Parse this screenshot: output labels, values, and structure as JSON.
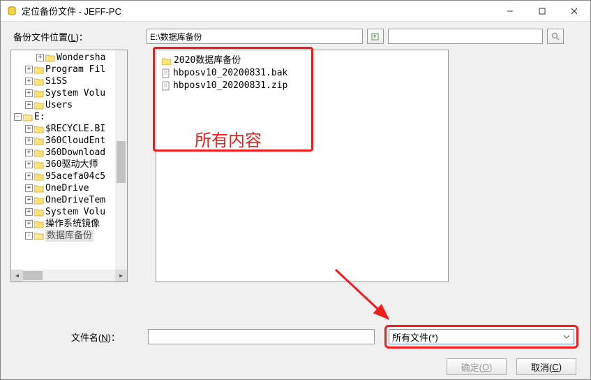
{
  "window": {
    "title": "定位备份文件 - JEFF-PC"
  },
  "labels": {
    "location": "备份文件位置(",
    "location_key": "L",
    "location_suffix": ")：",
    "filename": "文件名(",
    "filename_key": "N",
    "filename_suffix": ")："
  },
  "path": {
    "value": "E:\\数据库备份"
  },
  "tree": {
    "items": [
      {
        "indent": 2,
        "exp": "+",
        "label": "Wondersha"
      },
      {
        "indent": 1,
        "exp": "+",
        "label": "Program Fil"
      },
      {
        "indent": 1,
        "exp": "+",
        "label": "SiSS"
      },
      {
        "indent": 1,
        "exp": "+",
        "label": "System Volu"
      },
      {
        "indent": 1,
        "exp": "+",
        "label": "Users"
      },
      {
        "indent": 0,
        "exp": "-",
        "label": "E:"
      },
      {
        "indent": 1,
        "exp": "+",
        "label": "$RECYCLE.BI"
      },
      {
        "indent": 1,
        "exp": "+",
        "label": "360CloudEnt"
      },
      {
        "indent": 1,
        "exp": "+",
        "label": "360Download"
      },
      {
        "indent": 1,
        "exp": "+",
        "label": "360驱动大师"
      },
      {
        "indent": 1,
        "exp": "+",
        "label": "95acefa04c5"
      },
      {
        "indent": 1,
        "exp": "+",
        "label": "OneDrive"
      },
      {
        "indent": 1,
        "exp": "+",
        "label": "OneDriveTem"
      },
      {
        "indent": 1,
        "exp": "+",
        "label": "System Volu"
      },
      {
        "indent": 1,
        "exp": "+",
        "label": "操作系统镜像"
      },
      {
        "indent": 1,
        "exp": "-",
        "label": "数据库备份",
        "selected": true
      }
    ]
  },
  "files": {
    "items": [
      {
        "icon": "folder",
        "name": "2020数据库备份"
      },
      {
        "icon": "file",
        "name": "hbposv10_20200831.bak"
      },
      {
        "icon": "file",
        "name": "hbposv10_20200831.zip"
      }
    ]
  },
  "annotation": {
    "text": "所有内容"
  },
  "filter": {
    "selected": "所有文件(*)"
  },
  "buttons": {
    "ok": "确定(",
    "ok_key": "O",
    "ok_suffix": ")",
    "cancel": "取消(",
    "cancel_key": "C",
    "cancel_suffix": ")"
  }
}
